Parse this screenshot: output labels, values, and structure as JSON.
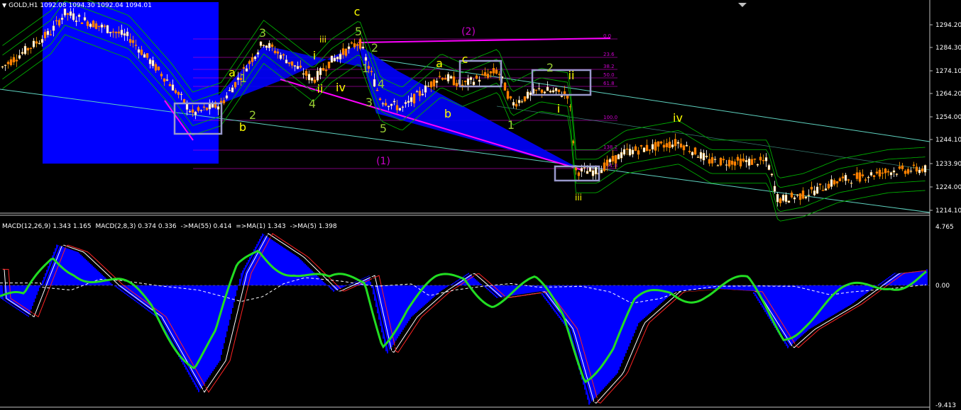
{
  "header": {
    "symbol": "GOLD,H1",
    "ohlc": "1092.08 1094.30 1092.04 1094.01"
  },
  "indicator_header": {
    "items": [
      "MACD(12,26,9) 1.343 1.165",
      "MACD(2,8,3) 0.374 0.336",
      "->MA(55) 0.414",
      "=>MA(1) 1.343",
      "->MA(5) 1.398"
    ]
  },
  "colors": {
    "background": "#000000",
    "bull_candle": "#ffa500",
    "bear_candle": "#ff7f00",
    "envelope": "#00aa00",
    "highlight_box": "#0000ff",
    "fib_lines": "#cc00cc",
    "channel": "#5fd3c0",
    "macd_hist": "#0000ff",
    "macd_fast": "#22dd22",
    "axis_text": "#ffffff",
    "wave_yellow": "#ffff00",
    "wave_green": "#99cc33",
    "wave_magenta": "#cc00cc"
  },
  "chart_data": [
    {
      "type": "candlestick",
      "name": "price",
      "y_ticks": [
        "1294.20",
        "1284.30",
        "1274.10",
        "1264.20",
        "1254.00",
        "1244.10",
        "1233.90",
        "1224.00",
        "1214.10"
      ],
      "ylim": [
        1210.5,
        1304.0
      ],
      "candles": [],
      "fib_levels": [
        "0.0",
        "23.6",
        "38.2",
        "50.0",
        "61.8",
        "100.0",
        "138.2",
        "161.8"
      ],
      "wave_labels": {
        "yellow": [
          "c",
          "a",
          "b",
          "iii",
          "i",
          "ii",
          "iv",
          "a",
          "c",
          "b",
          "i",
          "ii",
          "iv",
          "iii"
        ],
        "green": [
          "3",
          "5",
          "1",
          "2",
          "4",
          "2",
          "1",
          "3",
          "4",
          "5",
          "1",
          "2"
        ],
        "magenta": [
          "(2)",
          "(1)"
        ]
      }
    },
    {
      "type": "line",
      "name": "macd",
      "y_ticks": [
        "4.765",
        "0.00",
        "-9.413"
      ],
      "ylim": [
        -9.413,
        4.765
      ]
    }
  ]
}
